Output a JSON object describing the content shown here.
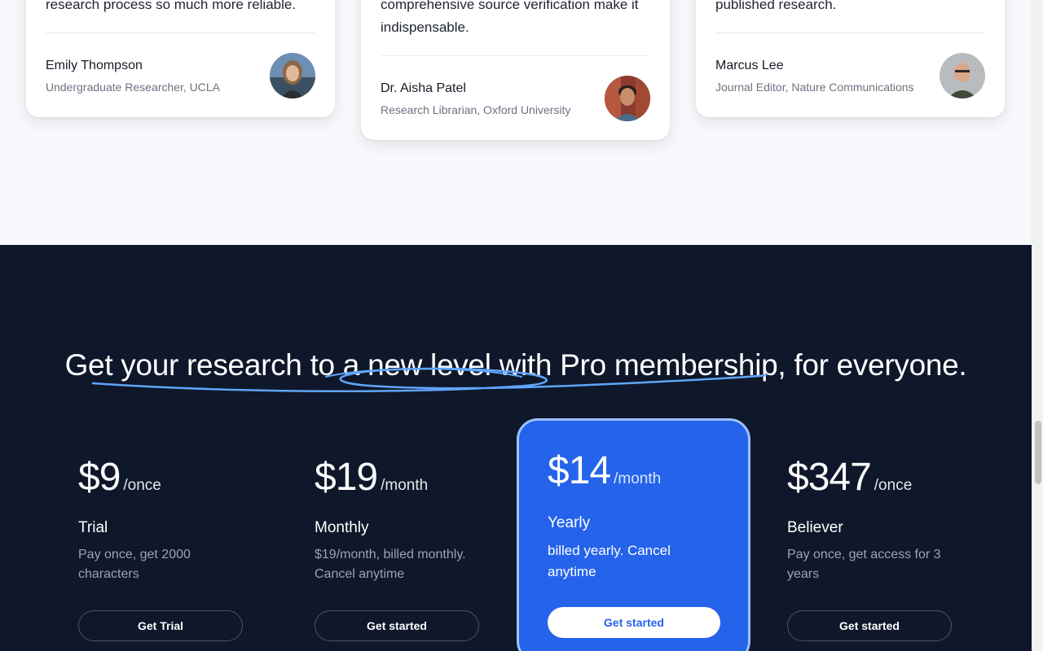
{
  "testimonials": [
    {
      "quote": "research process so much more reliable.",
      "name": "Emily Thompson",
      "role": "Undergraduate Researcher, UCLA",
      "avatar_icon": "avatar-emily-icon"
    },
    {
      "quote": "comprehensive source verification make it indispensable.",
      "name": "Dr. Aisha Patel",
      "role": "Research Librarian, Oxford University",
      "avatar_icon": "avatar-aisha-icon"
    },
    {
      "quote": "published research.",
      "name": "Marcus Lee",
      "role": "Journal Editor, Nature Communications",
      "avatar_icon": "avatar-marcus-icon"
    }
  ],
  "pricing": {
    "headline": "Get your research to a new level with Pro membership, for everyone.",
    "plans": [
      {
        "amount": "$9",
        "period": "/once",
        "name": "Trial",
        "description": "Pay once, get 2000 characters",
        "button": "Get Trial"
      },
      {
        "amount": "$19",
        "period": "/month",
        "name": "Monthly",
        "description": "$19/month, billed monthly. Cancel anytime",
        "button": "Get started"
      },
      {
        "amount": "$14",
        "period": "/month",
        "name": "Yearly",
        "description": "billed yearly. Cancel anytime",
        "button": "Get started",
        "featured": true
      },
      {
        "amount": "$347",
        "period": "/once",
        "name": "Believer",
        "description": "Pay once, get access for 3 years",
        "button": "Get started"
      }
    ]
  },
  "colors": {
    "page_background": "#f8f9fc",
    "dark_background": "#0f172a",
    "accent_blue": "#2563eb",
    "featured_border": "#9dc1ff",
    "scribble": "#60a5fa"
  }
}
